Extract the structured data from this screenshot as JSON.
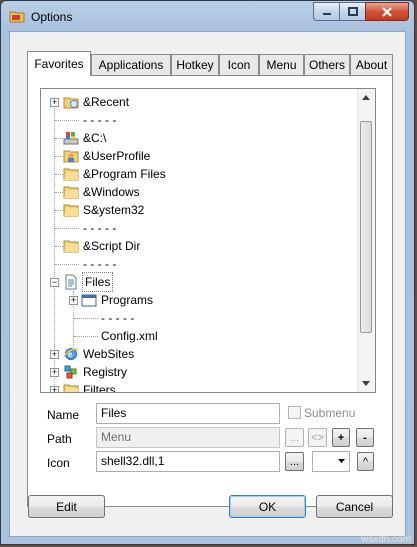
{
  "window": {
    "title": "Options"
  },
  "tabs": [
    {
      "label": "Favorites",
      "active": true
    },
    {
      "label": "Applications",
      "active": false
    },
    {
      "label": "Hotkey",
      "active": false
    },
    {
      "label": "Icon",
      "active": false
    },
    {
      "label": "Menu",
      "active": false
    },
    {
      "label": "Others",
      "active": false
    },
    {
      "label": "About",
      "active": false
    }
  ],
  "tree": {
    "items": [
      {
        "label": "&Recent",
        "icon": "recent-folder-icon",
        "expander": "+"
      },
      {
        "label": "- - - - -",
        "icon": "",
        "expander": ""
      },
      {
        "label": "&C:\\",
        "icon": "drive-icon",
        "expander": ""
      },
      {
        "label": "&UserProfile",
        "icon": "user-folder-icon",
        "expander": ""
      },
      {
        "label": "&Program Files",
        "icon": "folder-icon",
        "expander": ""
      },
      {
        "label": "&Windows",
        "icon": "folder-icon",
        "expander": ""
      },
      {
        "label": "S&ystem32",
        "icon": "folder-icon",
        "expander": ""
      },
      {
        "label": "- - - - -",
        "icon": "",
        "expander": ""
      },
      {
        "label": "&Script Dir",
        "icon": "folder-icon",
        "expander": ""
      },
      {
        "label": "- - - - -",
        "icon": "",
        "expander": ""
      },
      {
        "label": "Files",
        "icon": "document-icon",
        "expander": "-"
      },
      {
        "label": "Programs",
        "icon": "window-icon",
        "expander": "+"
      },
      {
        "label": "- - - - -",
        "icon": "",
        "expander": ""
      },
      {
        "label": "Config.xml",
        "icon": "",
        "expander": ""
      },
      {
        "label": "WebSites",
        "icon": "browser-icon",
        "expander": "+"
      },
      {
        "label": "Registry",
        "icon": "registry-icon",
        "expander": "+"
      },
      {
        "label": "Filters",
        "icon": "folder-icon",
        "expander": "+"
      }
    ]
  },
  "form": {
    "name_label": "Name",
    "name_value": "Files",
    "submenu_label": "Submenu",
    "path_label": "Path",
    "path_value": "Menu",
    "icon_label": "Icon",
    "icon_value": "shell32.dll,1",
    "browse_label": "...",
    "path_browse_label": "...",
    "swap_label": "<>",
    "plus_label": "+",
    "minus_label": "-",
    "up_label": "^"
  },
  "buttons": {
    "edit": "Edit",
    "ok": "OK",
    "cancel": "Cancel"
  },
  "watermark": "wsxdn.com"
}
